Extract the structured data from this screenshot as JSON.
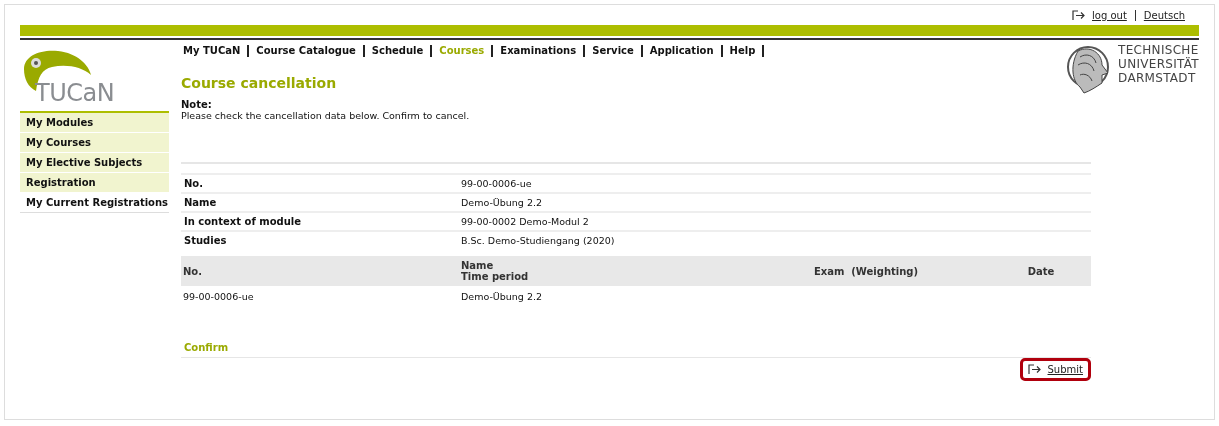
{
  "top_links": [
    {
      "label": "log out",
      "kind": "logout"
    },
    {
      "label": "Deutsch",
      "kind": "language"
    }
  ],
  "logo": {
    "text": "TUCaN"
  },
  "university": {
    "lines": [
      "TECHNISCHE",
      "UNIVERSITÄT",
      "DARMSTADT"
    ]
  },
  "nav": [
    {
      "label": "My TUCaN",
      "selected": false
    },
    {
      "label": "Course Catalogue",
      "selected": false
    },
    {
      "label": "Schedule",
      "selected": false
    },
    {
      "label": "Courses",
      "selected": true
    },
    {
      "label": "Examinations",
      "selected": false
    },
    {
      "label": "Service",
      "selected": false
    },
    {
      "label": "Application",
      "selected": false
    },
    {
      "label": "Help",
      "selected": false
    }
  ],
  "sidebar": {
    "items": [
      {
        "label": "My Modules",
        "selected": false
      },
      {
        "label": "My Courses",
        "selected": false
      },
      {
        "label": "My Elective Subjects",
        "selected": false
      },
      {
        "label": "Registration",
        "selected": false
      },
      {
        "label": "My Current Registrations",
        "selected": true
      }
    ]
  },
  "heading": "Course cancellation",
  "note": {
    "title": "Note:",
    "text": "Please check the cancellation data below. Confirm to cancel."
  },
  "details": [
    {
      "label": "No.",
      "value": "99-00-0006-ue"
    },
    {
      "label": "Name",
      "value": "Demo-Übung 2.2"
    },
    {
      "label": "In context of module",
      "value": "99-00-0002 Demo-Modul 2"
    },
    {
      "label": "Studies",
      "value": "B.Sc. Demo-Studiengang (2020)"
    }
  ],
  "table": {
    "columns": [
      "No.",
      "Name\nTime period",
      "Exam  (Weighting)",
      "Date"
    ],
    "rows": [
      [
        "99-00-0006-ue",
        "Demo-Übung 2.2",
        "",
        ""
      ]
    ]
  },
  "confirm": {
    "title": "Confirm",
    "submit": {
      "label": "Submit",
      "highlighted": true
    }
  }
}
